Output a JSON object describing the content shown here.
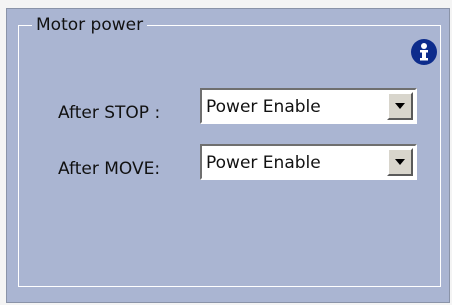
{
  "group": {
    "title": "Motor power"
  },
  "icons": {
    "info": "info-icon"
  },
  "rows": [
    {
      "label": "After STOP :",
      "value": "Power Enable"
    },
    {
      "label": "After MOVE:",
      "value": "Power Enable"
    }
  ],
  "colors": {
    "panel_background": "#aab5d2",
    "groupbox_border": "#ffffff",
    "info_icon": "#0d2c8c"
  }
}
